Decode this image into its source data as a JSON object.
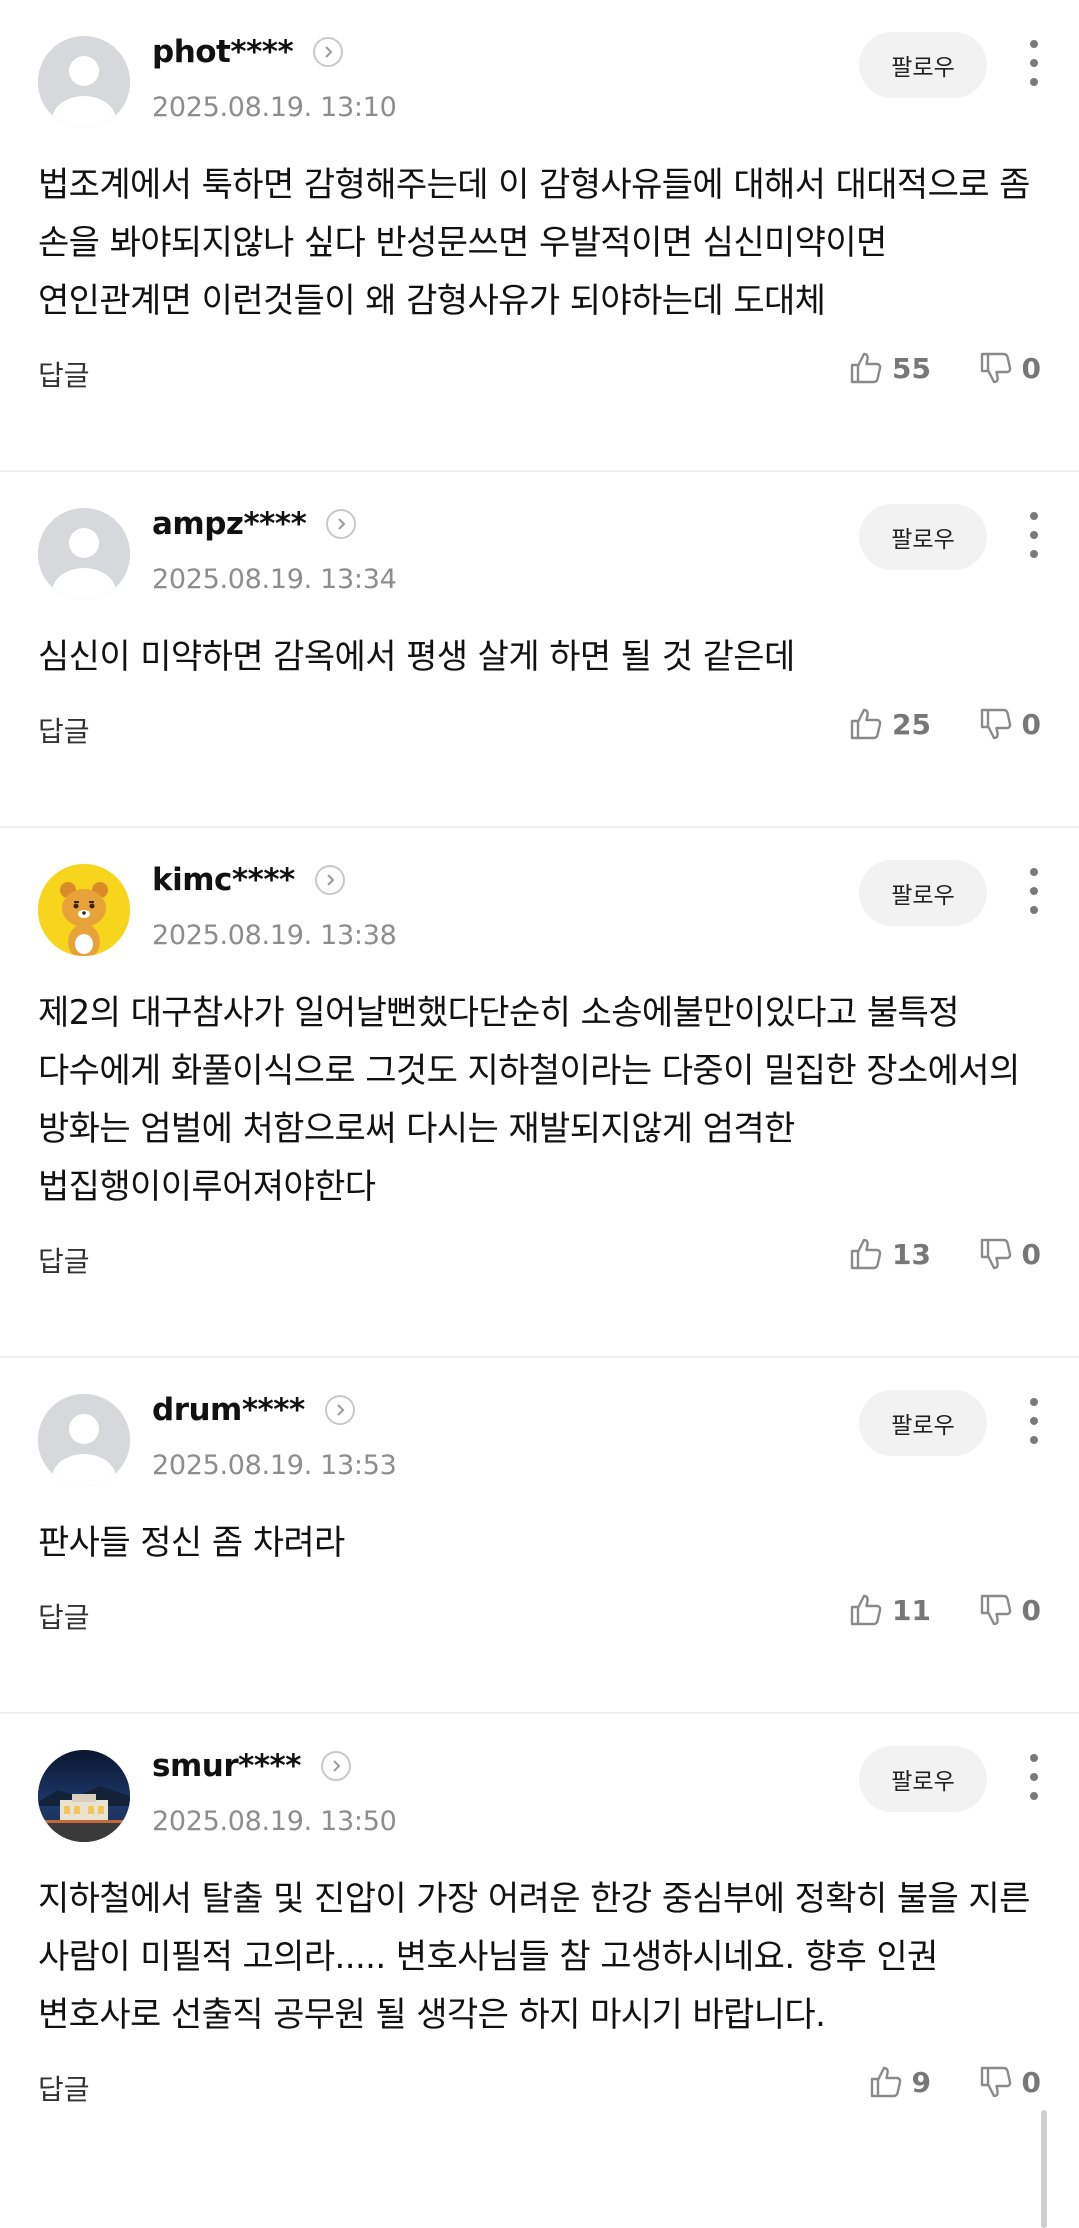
{
  "follow_label": "팔로우",
  "reply_label": "답글",
  "comments": [
    {
      "nickname": "phot****",
      "date": "2025.08.19. 13:10",
      "text": "법조계에서 툭하면 감형해주는데 이 감형사유들에 대해서 대대적으로 좀 손을 봐야되지않나 싶다 반성문쓰면 우발적이면 심신미약이면 연인관계면 이런것들이 왜 감형사유가 되야하는데 도대체",
      "likes": "55",
      "dislikes": "0",
      "avatar": "default-avatar-icon"
    },
    {
      "nickname": "ampz****",
      "date": "2025.08.19. 13:34",
      "text": "심신이 미약하면 감옥에서 평생 살게 하면 될 것 같은데",
      "likes": "25",
      "dislikes": "0",
      "avatar": "default-avatar-icon"
    },
    {
      "nickname": "kimc****",
      "date": "2025.08.19. 13:38",
      "text": "제2의 대구참사가 일어날뻔했다단순히 소송에불만이있다고 불특정 다수에게 화풀이식으로 그것도 지하철이라는 다중이 밀집한 장소에서의 방화는 엄벌에 처함으로써 다시는 재발되지않게 엄격한 법집행이이루어져야한다",
      "likes": "13",
      "dislikes": "0",
      "avatar": "bear-character-avatar"
    },
    {
      "nickname": "drum****",
      "date": "2025.08.19. 13:53",
      "text": "판사들 정신 좀 차려라",
      "likes": "11",
      "dislikes": "0",
      "avatar": "default-avatar-icon"
    },
    {
      "nickname": "smur****",
      "date": "2025.08.19. 13:50",
      "text": "지하철에서 탈출 및 진압이 가장 어려운 한강 중심부에 정확히 불을 지른 사람이 미필적 고의라..... 변호사님들 참 고생하시네요. 향후 인권 변호사로 선출직 공무원 될 생각은 하지 마시기 바랍니다.",
      "likes": "9",
      "dislikes": "0",
      "avatar": "night-building-photo-avatar"
    }
  ],
  "colors": {
    "date": "#8d8d8d",
    "count": "#777777",
    "divider": "#efefef",
    "follow_bg": "#f2f2f2",
    "kimc_avatar_bg": "#f7d51d"
  }
}
